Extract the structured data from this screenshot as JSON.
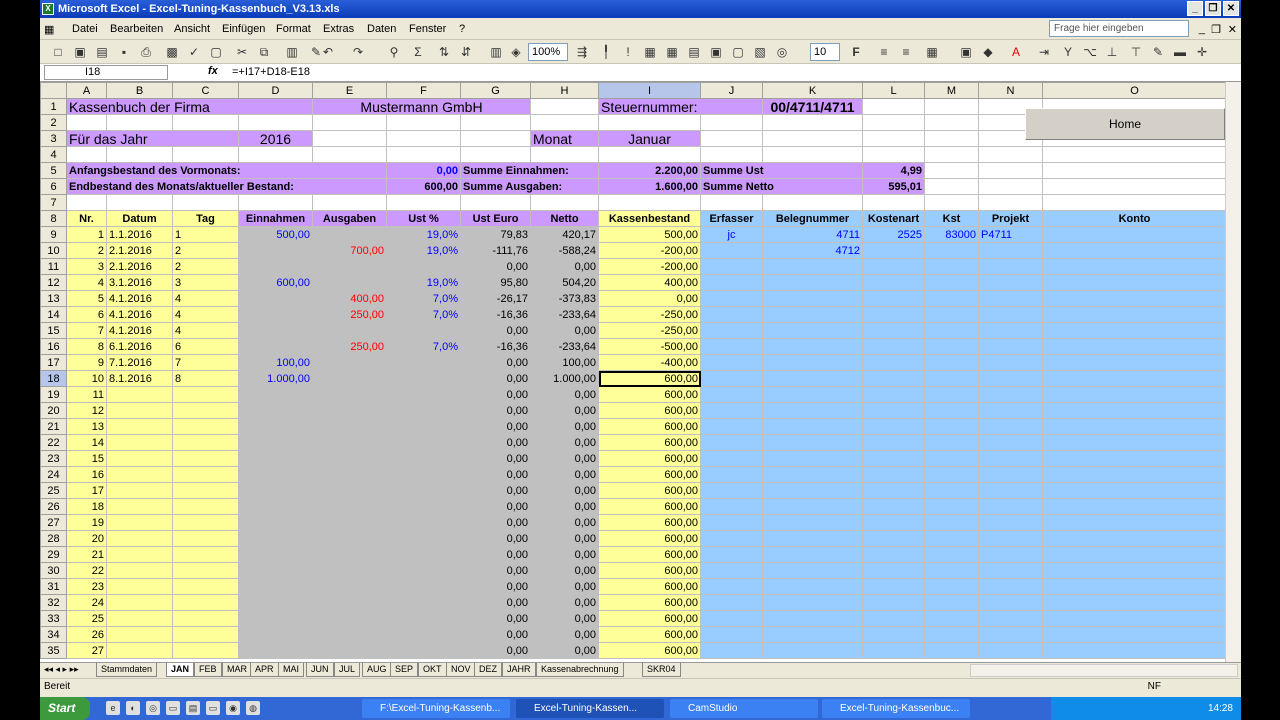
{
  "window": {
    "title": "Microsoft Excel - Excel-Tuning-Kassenbuch_V3.13.xls",
    "ask_placeholder": "Frage hier eingeben"
  },
  "menu": [
    "Datei",
    "Bearbeiten",
    "Ansicht",
    "Einfügen",
    "Format",
    "Extras",
    "Daten",
    "Fenster",
    "?"
  ],
  "toolbar": {
    "zoom": "100%",
    "font_size": "10",
    "bold": "F"
  },
  "formula_bar": {
    "cell_ref": "I18",
    "fx": "fx",
    "formula": "=+I17+D18-E18"
  },
  "columns": [
    "A",
    "B",
    "C",
    "D",
    "E",
    "F",
    "G",
    "H",
    "I",
    "J",
    "K",
    "L",
    "M",
    "N",
    "O"
  ],
  "sheet": {
    "r1": {
      "title": "Kassenbuch der Firma",
      "company": "Mustermann GmbH",
      "tax_label": "Steuernummer:",
      "tax_value": "00/4711/4711"
    },
    "r3": {
      "year_label": "Für das Jahr",
      "year": "2016",
      "month_label": "Monat",
      "month": "Januar"
    },
    "r5": {
      "label": "Anfangsbestand des Vormonats:",
      "value": "0,00",
      "label2": "Summe Einnahmen:",
      "value2": "2.200,00",
      "label3": "Summe Ust",
      "value3": "4,99"
    },
    "r6": {
      "label": "Endbestand des Monats/aktueller Bestand:",
      "value": "600,00",
      "label2": "Summe Ausgaben:",
      "value2": "1.600,00",
      "label3": "Summe Netto",
      "value3": "595,01"
    },
    "headers": [
      "Nr.",
      "Datum",
      "Tag",
      "Einnahmen",
      "Ausgaben",
      "Ust %",
      "Ust Euro",
      "Netto",
      "Kassenbestand",
      "Erfasser",
      "Belegnummer",
      "Kostenart",
      "Kst",
      "Projekt",
      "Konto"
    ],
    "rows": [
      [
        "1",
        "1.1.2016",
        "1",
        "500,00",
        "",
        "19,0%",
        "79,83",
        "420,17",
        "500,00",
        "jc",
        "4711",
        "2525",
        "83000",
        "P4711",
        ""
      ],
      [
        "2",
        "2.1.2016",
        "2",
        "",
        "700,00",
        "19,0%",
        "-111,76",
        "-588,24",
        "-200,00",
        "",
        "4712",
        "",
        "",
        "",
        ""
      ],
      [
        "3",
        "2.1.2016",
        "2",
        "",
        "",
        "",
        "0,00",
        "0,00",
        "-200,00",
        "",
        "",
        "",
        "",
        "",
        ""
      ],
      [
        "4",
        "3.1.2016",
        "3",
        "600,00",
        "",
        "19,0%",
        "95,80",
        "504,20",
        "400,00",
        "",
        "",
        "",
        "",
        "",
        ""
      ],
      [
        "5",
        "4.1.2016",
        "4",
        "",
        "400,00",
        "7,0%",
        "-26,17",
        "-373,83",
        "0,00",
        "",
        "",
        "",
        "",
        "",
        ""
      ],
      [
        "6",
        "4.1.2016",
        "4",
        "",
        "250,00",
        "7,0%",
        "-16,36",
        "-233,64",
        "-250,00",
        "",
        "",
        "",
        "",
        "",
        ""
      ],
      [
        "7",
        "4.1.2016",
        "4",
        "",
        "",
        "",
        "0,00",
        "0,00",
        "-250,00",
        "",
        "",
        "",
        "",
        "",
        ""
      ],
      [
        "8",
        "6.1.2016",
        "6",
        "",
        "250,00",
        "7,0%",
        "-16,36",
        "-233,64",
        "-500,00",
        "",
        "",
        "",
        "",
        "",
        ""
      ],
      [
        "9",
        "7.1.2016",
        "7",
        "100,00",
        "",
        "",
        "0,00",
        "100,00",
        "-400,00",
        "",
        "",
        "",
        "",
        "",
        ""
      ],
      [
        "10",
        "8.1.2016",
        "8",
        "1.000,00",
        "",
        "",
        "0,00",
        "1.000,00",
        "600,00",
        "",
        "",
        "",
        "",
        "",
        ""
      ]
    ],
    "empty_nrs": [
      "11",
      "12",
      "13",
      "14",
      "15",
      "16",
      "17",
      "18",
      "19",
      "20",
      "21",
      "22",
      "23",
      "24",
      "25",
      "26",
      "27"
    ],
    "empty_g": "0,00",
    "empty_h": "0,00",
    "empty_i": "600,00",
    "home_button": "Home"
  },
  "sheet_tabs": [
    "Stammdaten",
    "JAN",
    "FEB",
    "MAR",
    "APR",
    "MAI",
    "JUN",
    "JUL",
    "AUG",
    "SEP",
    "OKT",
    "NOV",
    "DEZ",
    "JAHR",
    "Kassenabrechnung",
    "SKR04"
  ],
  "status": {
    "left": "Bereit",
    "right": "NF"
  },
  "taskbar": {
    "start": "Start",
    "buttons": [
      "F:\\Excel-Tuning-Kassenb...",
      "Excel-Tuning-Kassen...",
      "CamStudio",
      "Excel-Tuning-Kassenbuc..."
    ],
    "clock": "14:28"
  }
}
